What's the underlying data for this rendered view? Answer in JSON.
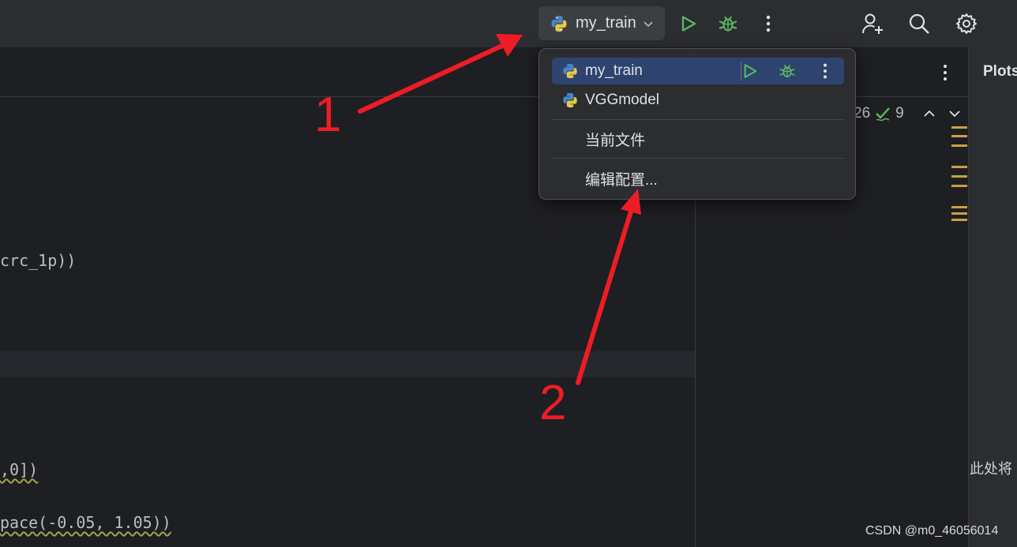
{
  "toolbar": {
    "run_config_label": "my_train",
    "icons": [
      "python-icon",
      "chevron-down-icon",
      "run-icon",
      "debug-icon",
      "more-vertical-icon",
      "add-user-icon",
      "search-icon",
      "gear-icon"
    ]
  },
  "editor": {
    "lines": [
      "crc_1p))",
      ",0])",
      "pace(-0.05, 1.05))"
    ]
  },
  "inspection": {
    "warnings": "26",
    "ok": "9"
  },
  "plots_panel": {
    "title": "Plots",
    "hint": "此处将"
  },
  "popup": {
    "items": [
      {
        "label": "my_train",
        "icon": "python-icon",
        "selected": true
      },
      {
        "label": "VGGmodel",
        "icon": "python-icon",
        "selected": false
      },
      {
        "label": "当前文件"
      },
      {
        "label": "编辑配置..."
      }
    ]
  },
  "annotations": {
    "marker1": "1",
    "marker2": "2"
  },
  "watermark": "CSDN @m0_46056014",
  "colors": {
    "toolbar_bg": "#2b2d30",
    "editor_bg": "#1e1f22",
    "selection": "#2e436e",
    "run_green": "#5fb865",
    "annotation_red": "#ee1c25"
  }
}
